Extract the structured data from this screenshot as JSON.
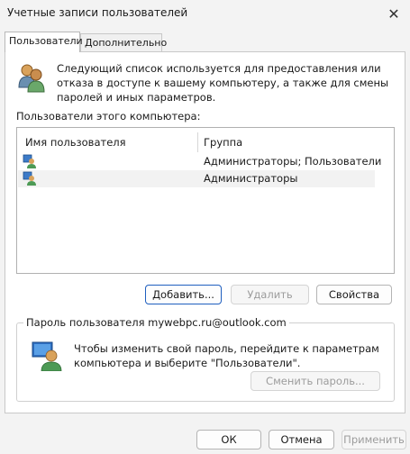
{
  "window": {
    "title": "Учетные записи пользователей",
    "close_glyph": "✕"
  },
  "tabs": [
    {
      "label": "Пользователи",
      "active": true
    },
    {
      "label": "Дополнительно",
      "active": false
    }
  ],
  "users_tab": {
    "description": "Следующий список используется для предоставления или отказа в доступе к вашему компьютеру, а также для смены паролей и иных параметров.",
    "users_list_label": "Пользователи этого компьютера:",
    "columns": [
      "Имя пользователя",
      "Группа"
    ],
    "rows": [
      {
        "name": "",
        "group": "Администраторы; Пользователи",
        "selected": false
      },
      {
        "name": "",
        "group": "Администраторы",
        "selected": true
      }
    ],
    "buttons": {
      "add": "Добавить...",
      "remove": "Удалить",
      "properties": "Свойства"
    },
    "password_group": {
      "legend": "Пароль пользователя mywebpc.ru@outlook.com",
      "text": "Чтобы изменить свой пароль, перейдите к параметрам компьютера и выберите \"Пользователи\".",
      "change_password": "Сменить пароль..."
    }
  },
  "footer": {
    "ok": "ОК",
    "cancel": "Отмена",
    "apply": "Применить"
  },
  "icons": {
    "header": "users-icon",
    "row": "user-icon",
    "password": "user-password-icon"
  },
  "colors": {
    "accent_border": "#1f5fbf",
    "window_bg": "#f3f3f3",
    "panel_bg": "#ffffff"
  }
}
